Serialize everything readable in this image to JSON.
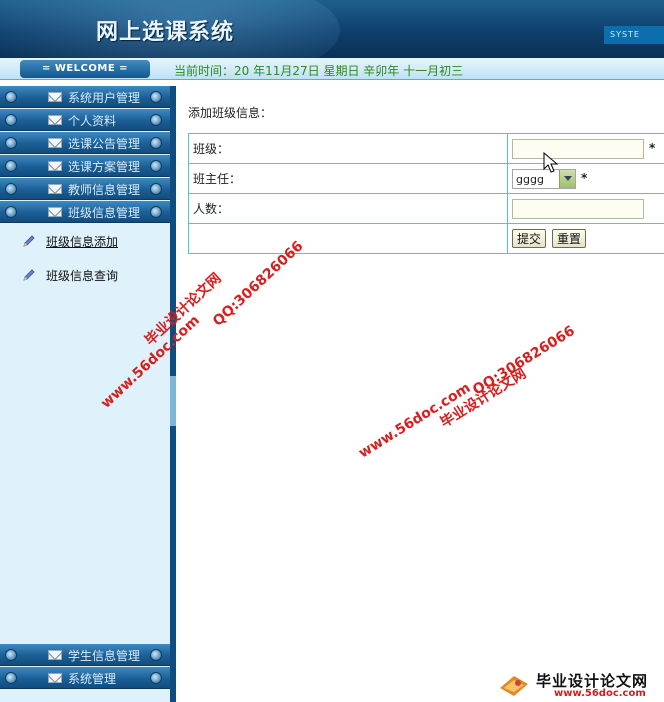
{
  "app": {
    "title": "网上选课系统",
    "system_badge": "SYSTE",
    "welcome": "= WELCOME =",
    "current_time": "当前时间：20   年11月27日  星期日  辛卯年  十一月初三"
  },
  "sidebar": {
    "top_items": [
      {
        "label": "系统用户管理"
      },
      {
        "label": "个人资料"
      },
      {
        "label": "选课公告管理"
      },
      {
        "label": "选课方案管理"
      },
      {
        "label": "教师信息管理"
      },
      {
        "label": "班级信息管理"
      }
    ],
    "sub_items": [
      {
        "label": "班级信息添加"
      },
      {
        "label": "班级信息查询"
      }
    ],
    "bottom_items": [
      {
        "label": "学生信息管理"
      },
      {
        "label": "系统管理"
      }
    ]
  },
  "form": {
    "title": "添加班级信息：",
    "class_label": "班级：",
    "class_value": "",
    "teacher_label": "班主任：",
    "teacher_selected": "gggg",
    "count_label": "人数：",
    "count_value": "",
    "required_mark": "*",
    "submit_label": "提交",
    "reset_label": "重置"
  },
  "watermarks": {
    "site_name": "毕业设计论文网",
    "url": "www.56doc.com",
    "qq": "QQ:306826066"
  },
  "footer_logo": {
    "title": "毕业设计论文网",
    "url": "www.56doc.com"
  }
}
